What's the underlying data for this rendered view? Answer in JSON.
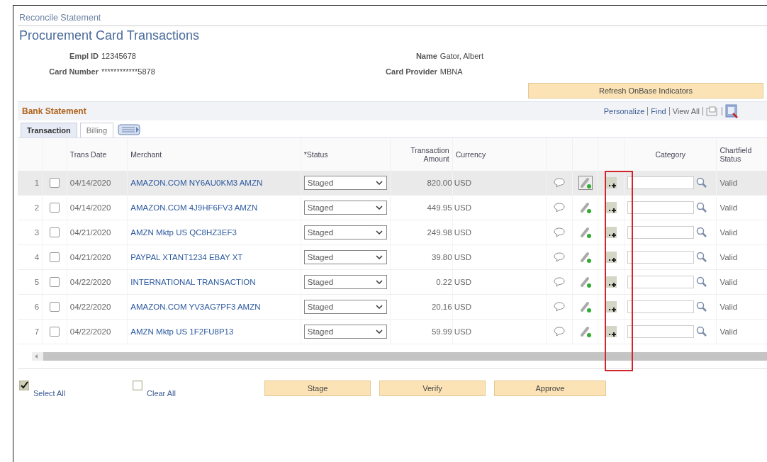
{
  "breadcrumb": "Reconcile Statement",
  "title": "Procurement Card Transactions",
  "fields_left": [
    {
      "label": "Empl ID",
      "value": "12345678"
    },
    {
      "label": "Card Number",
      "value": "************5878"
    }
  ],
  "fields_right": [
    {
      "label": "Name",
      "value": "Gator, Albert"
    },
    {
      "label": "Card Provider",
      "value": "MBNA"
    }
  ],
  "refresh_button": "Refresh OnBase Indicators",
  "grid": {
    "title": "Bank Statement",
    "links": [
      "Personalize",
      "Find",
      "View All"
    ],
    "tabs": [
      {
        "label": "Transaction",
        "selected": true
      },
      {
        "label": "Billing",
        "selected": false
      }
    ],
    "columns": [
      "Trans Date",
      "Merchant",
      "*Status",
      "Transaction Amount",
      "Currency",
      "Category",
      "Chartfield Status"
    ],
    "rows": [
      {
        "num": "1",
        "checked": false,
        "selected": true,
        "date": "04/14/2020",
        "merchant": "AMAZON.COM NY6AU0KM3 AMZN",
        "status": "Staged",
        "amount": "820.00",
        "currency": "USD",
        "chartfield": "Valid"
      },
      {
        "num": "2",
        "checked": false,
        "selected": false,
        "date": "04/14/2020",
        "merchant": "AMAZON.COM 4J9HF6FV3 AMZN",
        "status": "Staged",
        "amount": "449.95",
        "currency": "USD",
        "chartfield": "Valid"
      },
      {
        "num": "3",
        "checked": false,
        "selected": false,
        "date": "04/21/2020",
        "merchant": "AMZN Mktp US QC8HZ3EF3",
        "status": "Staged",
        "amount": "249.98",
        "currency": "USD",
        "chartfield": "Valid"
      },
      {
        "num": "4",
        "checked": false,
        "selected": false,
        "date": "04/21/2020",
        "merchant": "PAYPAL XTANT1234 EBAY XT",
        "status": "Staged",
        "amount": "39.80",
        "currency": "USD",
        "chartfield": "Valid"
      },
      {
        "num": "5",
        "checked": false,
        "selected": false,
        "date": "04/22/2020",
        "merchant": "INTERNATIONAL TRANSACTION",
        "status": "Staged",
        "amount": "0.22",
        "currency": "USD",
        "chartfield": "Valid"
      },
      {
        "num": "6",
        "checked": false,
        "selected": false,
        "date": "04/22/2020",
        "merchant": "AMAZON.COM YV3AG7PF3 AMZN",
        "status": "Staged",
        "amount": "20.16",
        "currency": "USD",
        "chartfield": "Valid"
      },
      {
        "num": "7",
        "checked": false,
        "selected": false,
        "date": "04/22/2020",
        "merchant": "AMZN Mktp US 1F2FU8P13",
        "status": "Staged",
        "amount": "59.99",
        "currency": "USD",
        "chartfield": "Valid"
      }
    ]
  },
  "select_links": [
    {
      "label": "Select All",
      "kind": "select"
    },
    {
      "label": "Clear All",
      "kind": "clear"
    }
  ],
  "action_buttons": [
    "Stage",
    "Verify",
    "Approve"
  ]
}
